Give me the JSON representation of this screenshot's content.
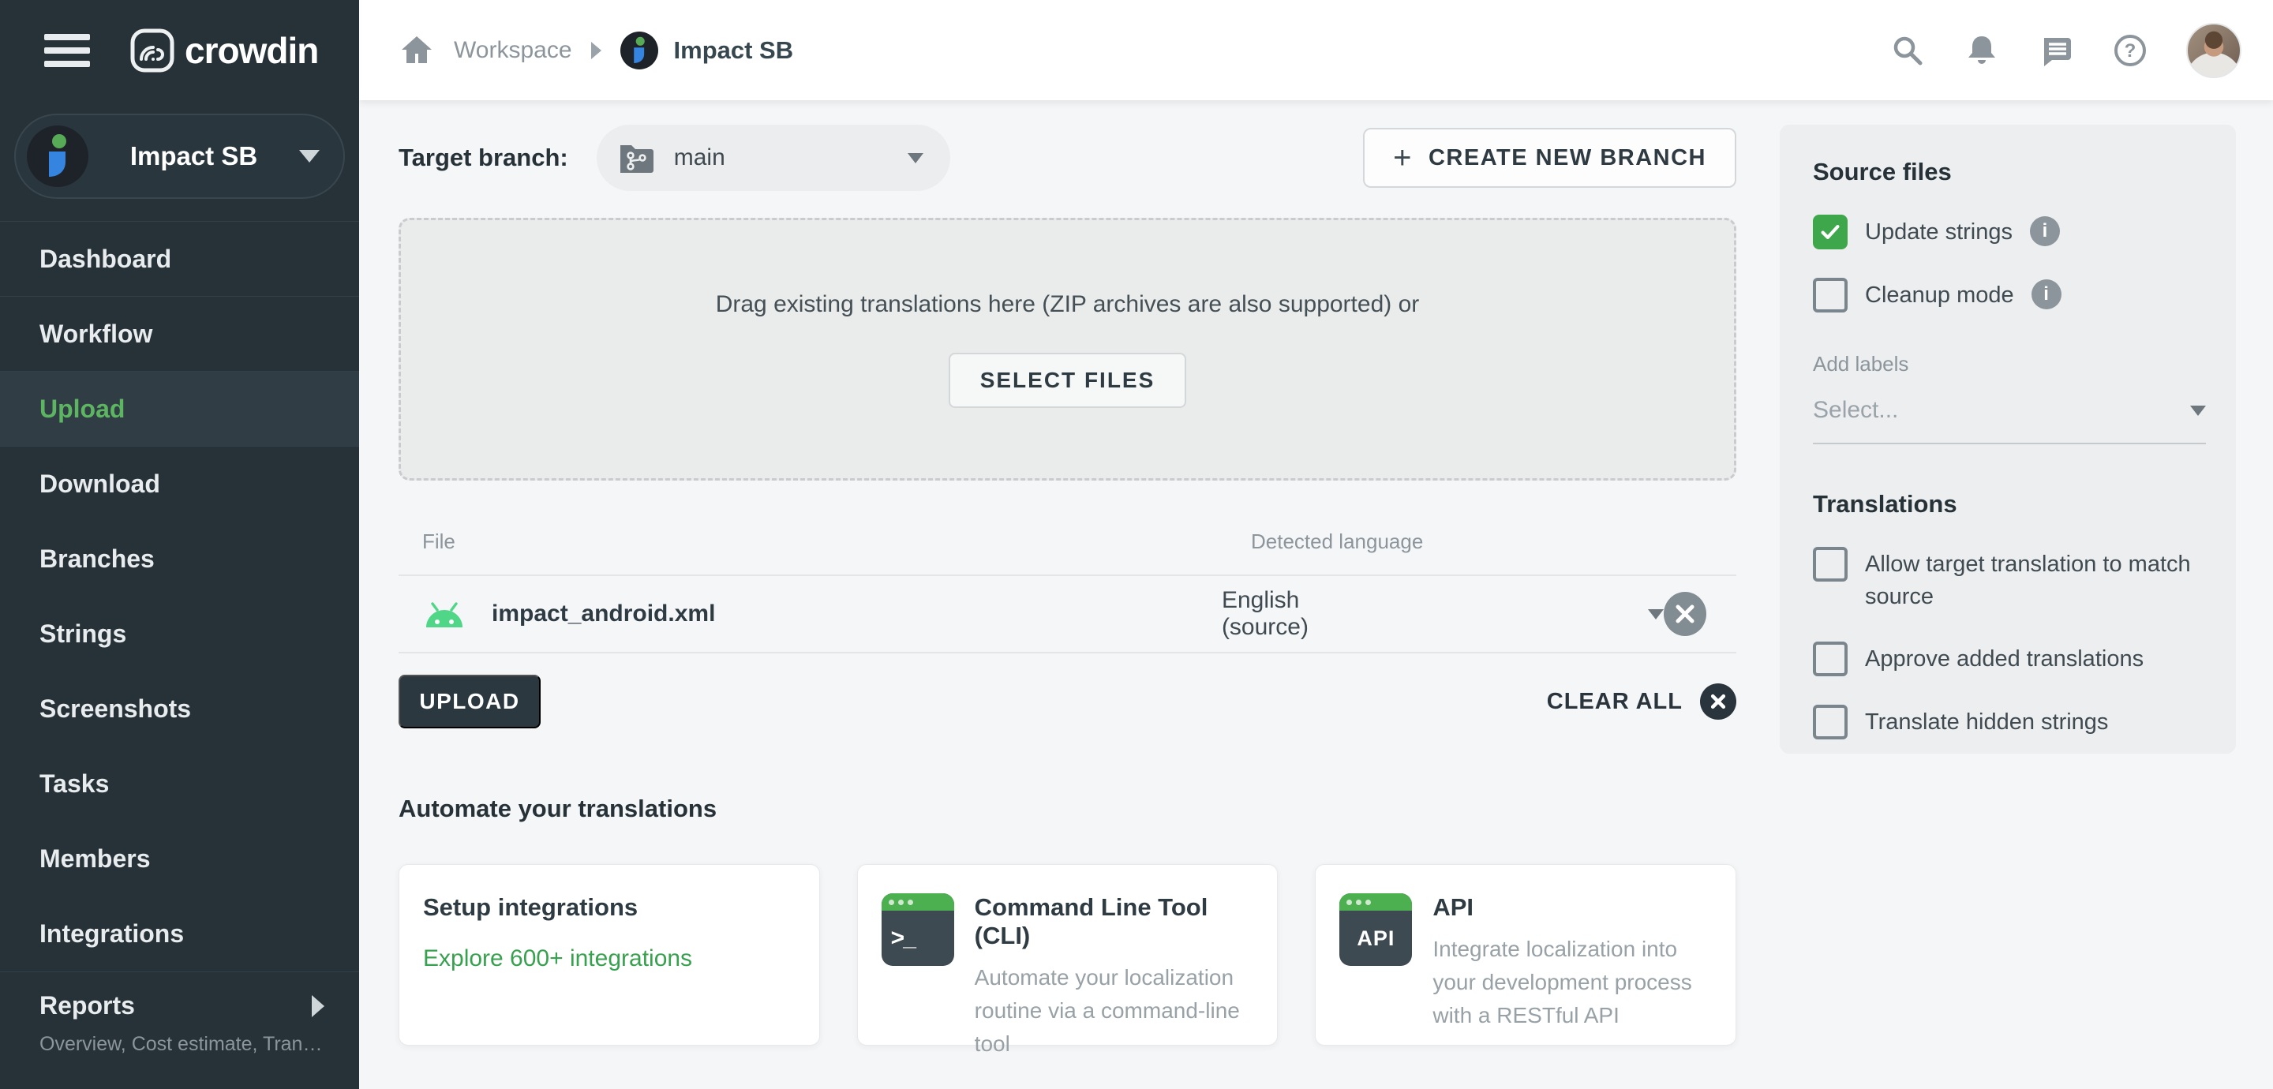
{
  "app": {
    "logo_text": "crowdin",
    "colors": {
      "sidebar_dark": "#263238",
      "active_nav_green": "#5db561",
      "checkbox_green": "#3ea64b",
      "link_green": "#38a14f",
      "android_green": "#4fd687",
      "icon_gray": "#8b959b",
      "page_bg": "#f5f6f8"
    },
    "icons": {
      "hamburger": "menu",
      "home": "house",
      "search": "magnifier",
      "notifications": "bell",
      "messages": "chat-bubble",
      "help": "question-circle",
      "branch_folder": "folder-with-git-branch",
      "android": "android-robot-head",
      "close": "x-in-circle",
      "info": "i-in-circle",
      "terminal": "dark-window-green-bar",
      "api": "dark-window-green-bar"
    }
  },
  "topbar": {
    "breadcrumb": {
      "workspace": "Workspace",
      "project": "Impact SB"
    }
  },
  "sidebar": {
    "project": {
      "name": "Impact SB"
    },
    "items": [
      {
        "label": "Dashboard",
        "active": false
      },
      {
        "label": "Workflow",
        "active": false
      },
      {
        "label": "Upload",
        "active": true
      },
      {
        "label": "Download",
        "active": false
      },
      {
        "label": "Branches",
        "active": false
      },
      {
        "label": "Strings",
        "active": false
      },
      {
        "label": "Screenshots",
        "active": false
      },
      {
        "label": "Tasks",
        "active": false
      },
      {
        "label": "Members",
        "active": false
      },
      {
        "label": "Integrations",
        "active": false
      }
    ],
    "reports": {
      "label": "Reports",
      "subtitle": "Overview, Cost estimate, Transl…"
    }
  },
  "main": {
    "branch": {
      "label": "Target branch:",
      "value": "main"
    },
    "create_branch": {
      "plus": "+",
      "label": "CREATE NEW BRANCH"
    },
    "dropzone": {
      "text": "Drag existing translations here (ZIP archives are also supported) or",
      "select_files_button": "SELECT FILES"
    },
    "files_table": {
      "columns": {
        "file": "File",
        "language": "Detected language"
      },
      "rows": [
        {
          "file": "impact_android.xml",
          "detected_language": "English (source)"
        }
      ]
    },
    "upload_button": "UPLOAD",
    "clear_all_label": "CLEAR ALL",
    "automate_heading": "Automate your translations",
    "cards": [
      {
        "title": "Setup integrations",
        "link": "Explore 600+ integrations"
      },
      {
        "title": "Command Line Tool (CLI)",
        "icon_text": ">_",
        "description": "Automate your localization routine via a command-line tool"
      },
      {
        "title": "API",
        "icon_text": "API",
        "description": "Integrate localization into your development process with a RESTful API"
      }
    ]
  },
  "settings_panel": {
    "source_files": {
      "heading": "Source files",
      "options": [
        {
          "label": "Update strings",
          "checked": true,
          "has_info": true
        },
        {
          "label": "Cleanup mode",
          "checked": false,
          "has_info": true
        }
      ],
      "add_labels_label": "Add labels",
      "labels_select_placeholder": "Select..."
    },
    "translations": {
      "heading": "Translations",
      "options": [
        {
          "label": "Allow target translation to match source",
          "checked": false
        },
        {
          "label": "Approve added translations",
          "checked": false
        },
        {
          "label": "Translate hidden strings",
          "checked": false
        }
      ]
    }
  }
}
